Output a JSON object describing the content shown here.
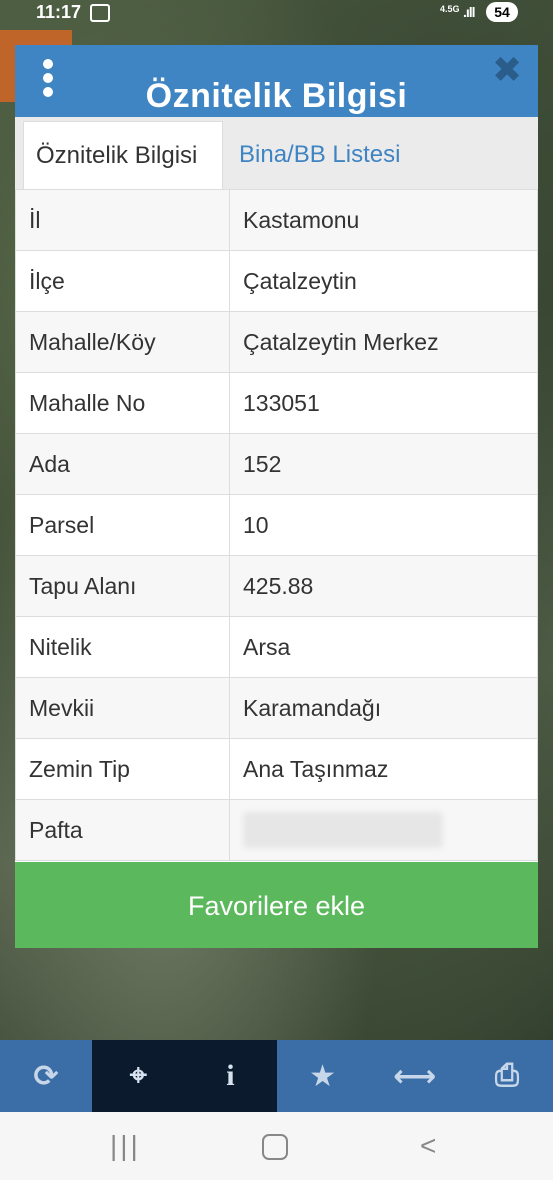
{
  "status": {
    "time": "11:17",
    "network": "4.5G",
    "battery": "54"
  },
  "dialog": {
    "title": "Öznitelik Bilgisi",
    "tabs": [
      {
        "label": "Öznitelik Bilgisi"
      },
      {
        "label": "Bina/BB Listesi"
      }
    ],
    "rows": [
      {
        "label": "İl",
        "value": "Kastamonu"
      },
      {
        "label": "İlçe",
        "value": "Çatalzeytin"
      },
      {
        "label": "Mahalle/Köy",
        "value": "Çatalzeytin Merkez"
      },
      {
        "label": "Mahalle No",
        "value": "133051"
      },
      {
        "label": "Ada",
        "value": "152"
      },
      {
        "label": "Parsel",
        "value": "10"
      },
      {
        "label": "Tapu Alanı",
        "value": "425.88"
      },
      {
        "label": "Nitelik",
        "value": "Arsa"
      },
      {
        "label": "Mevkii",
        "value": "Karamandağı"
      },
      {
        "label": "Zemin Tip",
        "value": "Ana Taşınmaz"
      },
      {
        "label": "Pafta",
        "value": ""
      }
    ],
    "favorite_button": "Favorilere ekle"
  },
  "toolbar": {
    "items": [
      {
        "icon": "refresh-icon",
        "glyph": "⟳"
      },
      {
        "icon": "locate-icon",
        "glyph": "⌖"
      },
      {
        "icon": "info-icon",
        "glyph": "i"
      },
      {
        "icon": "star-icon",
        "glyph": "★"
      },
      {
        "icon": "measure-icon",
        "glyph": "⟷"
      },
      {
        "icon": "print-icon",
        "glyph": "⎙"
      }
    ]
  },
  "nav": {
    "recent": "|||",
    "back": "<"
  },
  "colors": {
    "header": "#3f84c3",
    "button": "#5cb85c",
    "toolbar": "#3b6ea6"
  }
}
